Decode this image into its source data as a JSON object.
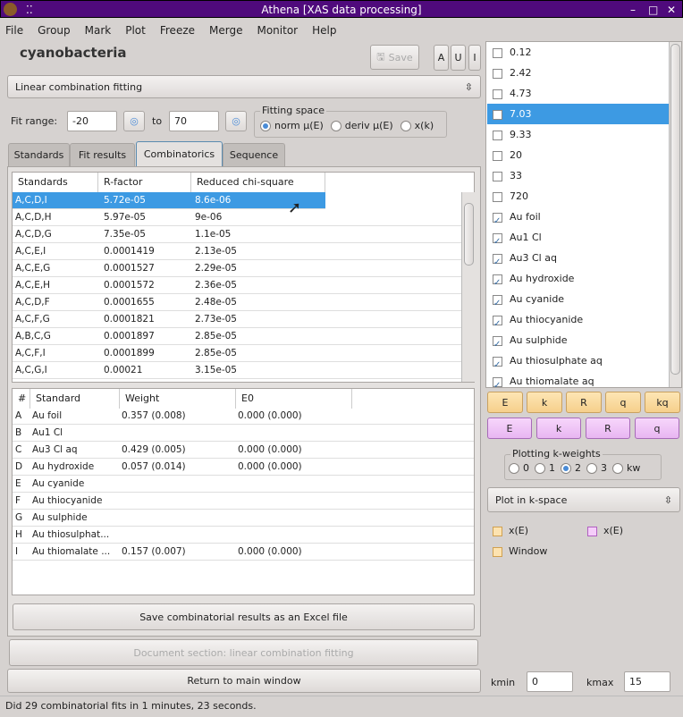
{
  "window": {
    "title": "Athena [XAS data processing]"
  },
  "menu": [
    "File",
    "Group",
    "Mark",
    "Plot",
    "Freeze",
    "Merge",
    "Monitor",
    "Help"
  ],
  "group_name": "cyanobacteria",
  "toolbar": {
    "save": "Save",
    "a": "A",
    "u": "U",
    "i": "I"
  },
  "analysis_select": "Linear combination fitting",
  "fit_range": {
    "label": "Fit range:",
    "from": "-20",
    "to_label": "to",
    "to": "70"
  },
  "fitting_space": {
    "title": "Fitting space",
    "options": [
      "norm μ(E)",
      "deriv μ(E)",
      "x(k)"
    ],
    "selected": 0
  },
  "tabs": [
    "Standards",
    "Fit results",
    "Combinatorics",
    "Sequence"
  ],
  "active_tab": 2,
  "combo_table": {
    "headers": [
      "Standards",
      "R-factor",
      "Reduced chi-square"
    ],
    "rows": [
      [
        "A,C,D,I",
        "5.72e-05",
        "8.6e-06"
      ],
      [
        "A,C,D,H",
        "5.97e-05",
        "9e-06"
      ],
      [
        "A,C,D,G",
        "7.35e-05",
        "1.1e-05"
      ],
      [
        "A,C,E,I",
        "0.0001419",
        "2.13e-05"
      ],
      [
        "A,C,E,G",
        "0.0001527",
        "2.29e-05"
      ],
      [
        "A,C,E,H",
        "0.0001572",
        "2.36e-05"
      ],
      [
        "A,C,D,F",
        "0.0001655",
        "2.48e-05"
      ],
      [
        "A,C,F,G",
        "0.0001821",
        "2.73e-05"
      ],
      [
        "A,B,C,G",
        "0.0001897",
        "2.85e-05"
      ],
      [
        "A,C,F,I",
        "0.0001899",
        "2.85e-05"
      ],
      [
        "A,C,G,I",
        "0.00021",
        "3.15e-05"
      ]
    ],
    "selected": 0
  },
  "weights_table": {
    "headers": [
      "#",
      "Standard",
      "Weight",
      "E0"
    ],
    "rows": [
      [
        "A",
        "Au foil",
        "0.357 (0.008)",
        "0.000 (0.000)"
      ],
      [
        "B",
        "Au1 Cl",
        "",
        ""
      ],
      [
        "C",
        "Au3 Cl aq",
        "0.429 (0.005)",
        "0.000 (0.000)"
      ],
      [
        "D",
        "Au hydroxide",
        "0.057 (0.014)",
        "0.000 (0.000)"
      ],
      [
        "E",
        "Au cyanide",
        "",
        ""
      ],
      [
        "F",
        "Au thiocyanide",
        "",
        ""
      ],
      [
        "G",
        "Au sulphide",
        "",
        ""
      ],
      [
        "H",
        "Au thiosulphat...",
        "",
        ""
      ],
      [
        "I",
        "Au thiomalate ...",
        "0.157 (0.007)",
        "0.000 (0.000)"
      ]
    ]
  },
  "buttons": {
    "save_excel": "Save combinatorial results as an Excel file",
    "document": "Document section: linear combination fitting",
    "return": "Return to main window"
  },
  "status": "Did 29 combinatorial fits in 1 minutes, 23 seconds.",
  "group_list": {
    "items": [
      {
        "label": "0.12",
        "checked": false
      },
      {
        "label": "2.42",
        "checked": false
      },
      {
        "label": "4.73",
        "checked": false
      },
      {
        "label": "7.03",
        "checked": false
      },
      {
        "label": "9.33",
        "checked": false
      },
      {
        "label": "20",
        "checked": false
      },
      {
        "label": "33",
        "checked": false
      },
      {
        "label": "720",
        "checked": false
      },
      {
        "label": "Au foil",
        "checked": true
      },
      {
        "label": "Au1 Cl",
        "checked": true
      },
      {
        "label": "Au3 Cl aq",
        "checked": true
      },
      {
        "label": "Au hydroxide",
        "checked": true
      },
      {
        "label": "Au cyanide",
        "checked": true
      },
      {
        "label": "Au thiocyanide",
        "checked": true
      },
      {
        "label": "Au sulphide",
        "checked": true
      },
      {
        "label": "Au thiosulphate aq",
        "checked": true
      },
      {
        "label": "Au thiomalate aq",
        "checked": true
      }
    ],
    "selected": 3
  },
  "plot_buttons_single": [
    "E",
    "k",
    "R",
    "q",
    "kq"
  ],
  "plot_buttons_marked": [
    "E",
    "k",
    "R",
    "q"
  ],
  "kweights": {
    "title": "Plotting k-weights",
    "options": [
      "0",
      "1",
      "2",
      "3",
      "kw"
    ],
    "selected": 2
  },
  "plot_space_select": "Plot in k-space",
  "plot_options": {
    "single_xe": "x(E)",
    "marked_xe": "x(E)",
    "window": "Window"
  },
  "kmin": {
    "label": "kmin",
    "value": "0"
  },
  "kmax": {
    "label": "kmax",
    "value": "15"
  },
  "colors": {
    "titlebar": "#4f0a7c",
    "selection": "#3d9ae3",
    "single_plot": "#f6d08c",
    "marked_plot": "#e8b6f2"
  }
}
